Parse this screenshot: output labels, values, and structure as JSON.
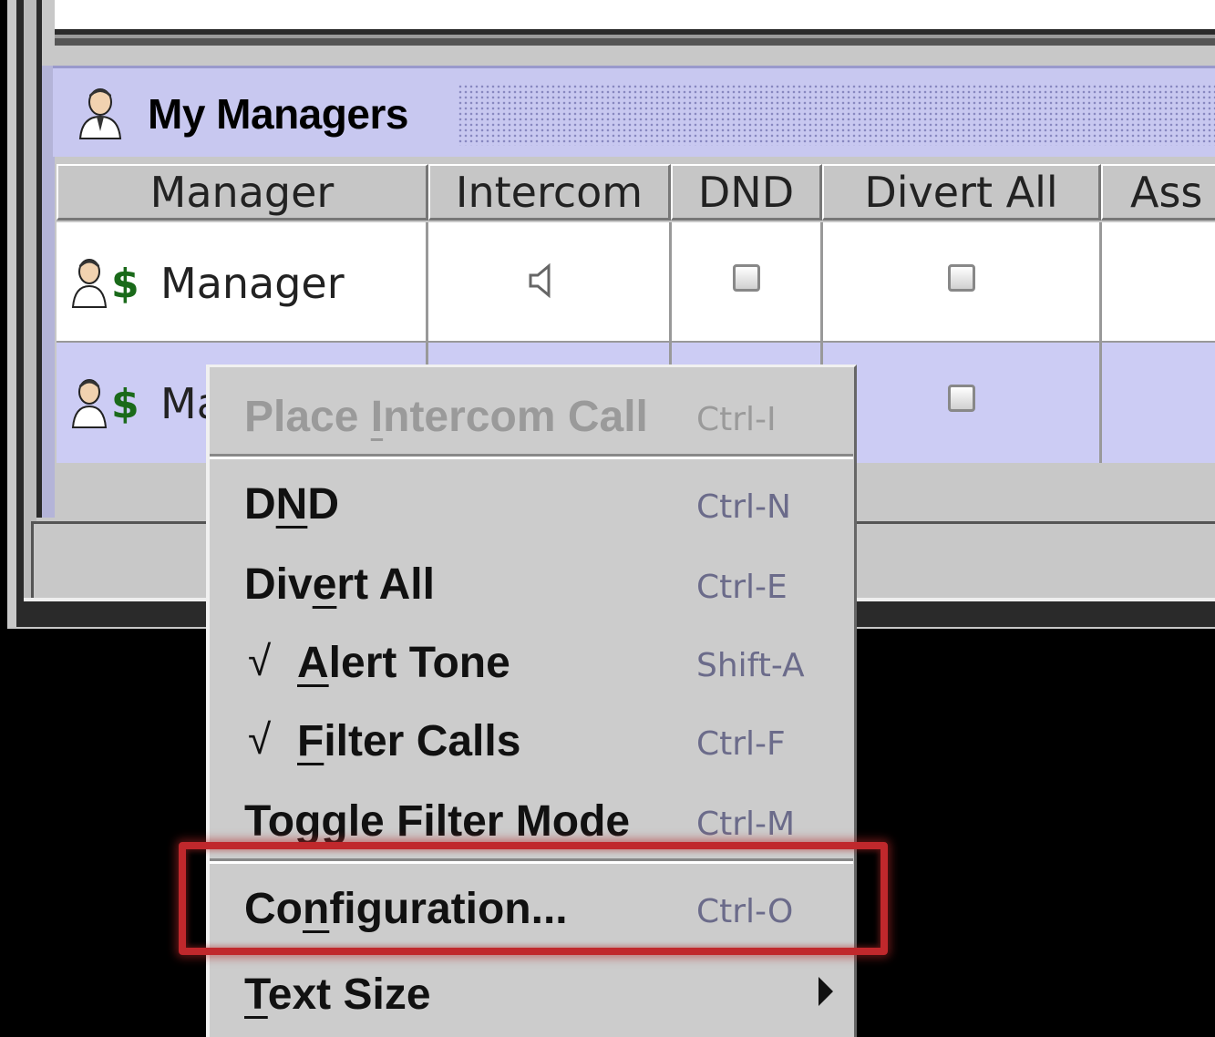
{
  "panel": {
    "title": "My Managers"
  },
  "table": {
    "columns": [
      "Manager",
      "Intercom",
      "DND",
      "Divert All",
      "Ass"
    ],
    "rows": [
      {
        "manager": "Manager",
        "intercom_icon": "speaker-icon",
        "dnd": false,
        "divert_all": false
      },
      {
        "manager": "Ma",
        "dnd": false,
        "divert_all": false
      }
    ]
  },
  "context_menu": {
    "items": [
      {
        "label_pre": "Place ",
        "label_u": "I",
        "label_post": "ntercom Call",
        "shortcut": "Ctrl-I",
        "enabled": false
      },
      {
        "label_pre": "D",
        "label_u": "N",
        "label_post": "D",
        "shortcut": "Ctrl-N",
        "enabled": true
      },
      {
        "label_pre": "Div",
        "label_u": "e",
        "label_post": "rt All",
        "shortcut": "Ctrl-E",
        "enabled": true
      },
      {
        "check": "√",
        "label_pre": "",
        "label_u": "A",
        "label_post": "lert Tone",
        "shortcut": "Shift-A",
        "enabled": true,
        "checked": true
      },
      {
        "check": "√",
        "label_pre": "",
        "label_u": "F",
        "label_post": "ilter Calls",
        "shortcut": "Ctrl-F",
        "enabled": true,
        "checked": true
      },
      {
        "label_pre": "Toggle Filter Mode",
        "label_u": "",
        "label_post": "",
        "shortcut": "Ctrl-M",
        "enabled": true
      },
      {
        "label_pre": "Co",
        "label_u": "n",
        "label_post": "figuration...",
        "shortcut": "Ctrl-O",
        "enabled": true,
        "highlighted": true
      },
      {
        "label_pre": "",
        "label_u": "T",
        "label_post": "ext Size",
        "shortcut": "",
        "enabled": true,
        "submenu": true
      }
    ]
  },
  "colors": {
    "header_bg": "#c8c8f0",
    "selected_row": "#ccccf4",
    "highlight_border": "#c0282c"
  }
}
